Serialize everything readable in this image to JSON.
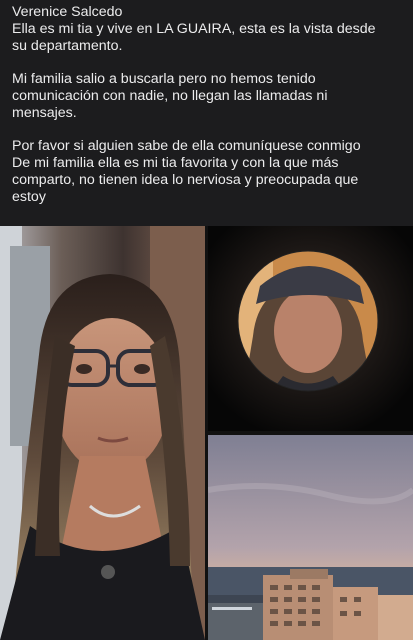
{
  "post": {
    "author": "Verenice Salcedo",
    "paragraphs": [
      "Ella es mi tia y vive en LA GUAIRA, esta es la vista desde\nsu departamento.",
      "Mi familia salio a buscarla pero no hemos tenido\ncomunicación con nadie, no llegan las llamadas ni\nmensajes.",
      "Por favor si alguien sabe de ella comuníquese conmigo\nDe mi familia ella es mi tia favorita y con la que más\ncomparto, no tienen idea lo nerviosa y preocupada que\nestoy"
    ]
  },
  "photos": [
    {
      "name": "selfie-woman-glasses-photo",
      "content": "portrait"
    },
    {
      "name": "woman-cap-circle-photo",
      "content": "portrait"
    },
    {
      "name": "coastal-view-photo",
      "content": "landscape"
    }
  ],
  "colors": {
    "background": "#1c1c1e",
    "text": "#ececed",
    "sky_top": "#8e8ea0",
    "sky_bottom": "#d9b39a",
    "sea": "#4a5566"
  }
}
